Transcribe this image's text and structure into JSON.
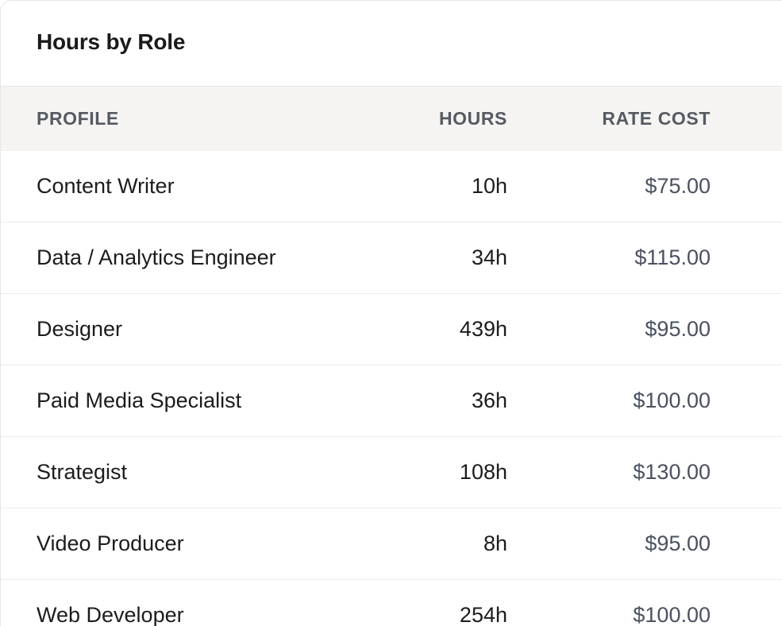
{
  "card": {
    "title": "Hours by Role"
  },
  "table": {
    "headers": {
      "profile": "PROFILE",
      "hours": "HOURS",
      "rate_cost": "RATE COST"
    },
    "rows": [
      {
        "profile": "Content Writer",
        "hours": "10h",
        "rate": "$75.00"
      },
      {
        "profile": "Data / Analytics Engineer",
        "hours": "34h",
        "rate": "$115.00"
      },
      {
        "profile": "Designer",
        "hours": "439h",
        "rate": "$95.00"
      },
      {
        "profile": "Paid Media Specialist",
        "hours": "36h",
        "rate": "$100.00"
      },
      {
        "profile": "Strategist",
        "hours": "108h",
        "rate": "$130.00"
      },
      {
        "profile": "Video Producer",
        "hours": "8h",
        "rate": "$95.00"
      },
      {
        "profile": "Web Developer",
        "hours": "254h",
        "rate": "$100.00"
      }
    ]
  }
}
